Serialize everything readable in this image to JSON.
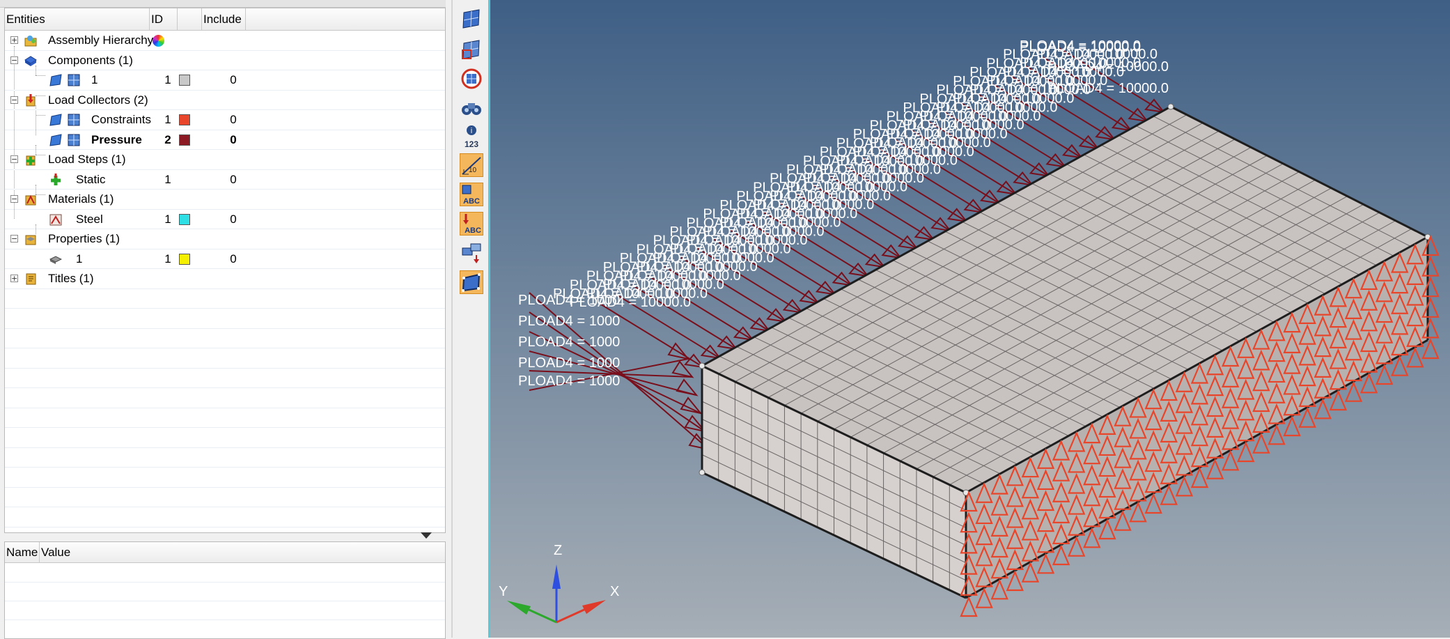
{
  "entities_panel": {
    "headers": {
      "entities": "Entities",
      "id": "ID",
      "include": "Include"
    },
    "rows": [
      {
        "label": "Assembly Hierarchy",
        "id": "",
        "include": "",
        "color": "",
        "bold": false
      },
      {
        "label": "Components (1)",
        "id": "",
        "include": "",
        "color": "",
        "bold": false
      },
      {
        "label": "1",
        "id": "1",
        "include": "0",
        "color": "#c8c8c8",
        "bold": false
      },
      {
        "label": "Load Collectors (2)",
        "id": "",
        "include": "",
        "color": "",
        "bold": false
      },
      {
        "label": "Constraints",
        "id": "1",
        "include": "0",
        "color": "#e8452a",
        "bold": false
      },
      {
        "label": "Pressure",
        "id": "2",
        "include": "0",
        "color": "#8b1a24",
        "bold": true
      },
      {
        "label": "Load Steps (1)",
        "id": "",
        "include": "",
        "color": "",
        "bold": false
      },
      {
        "label": "Static",
        "id": "1",
        "include": "0",
        "color": "",
        "bold": false
      },
      {
        "label": "Materials (1)",
        "id": "",
        "include": "",
        "color": "",
        "bold": false
      },
      {
        "label": "Steel",
        "id": "1",
        "include": "0",
        "color": "#2ee0e6",
        "bold": false
      },
      {
        "label": "Properties (1)",
        "id": "",
        "include": "",
        "color": "",
        "bold": false
      },
      {
        "label": "1",
        "id": "1",
        "include": "0",
        "color": "#f4f000",
        "bold": false
      },
      {
        "label": "Titles (1)",
        "id": "",
        "include": "",
        "color": "",
        "bold": false
      }
    ]
  },
  "properties_panel": {
    "headers": {
      "name": "Name",
      "value": "Value"
    }
  },
  "toolbar": {
    "icons": [
      "mesh-view-icon",
      "shaded-elements-icon",
      "element-color-icon",
      "find-binoculars-icon",
      "entity-numbers-icon",
      "scale-icon",
      "label-abc-icon",
      "load-label-abc-icon",
      "transform-icon",
      "component-edges-icon"
    ],
    "numbers_label": "123",
    "scale_label": "10"
  },
  "viewport": {
    "load_label": "PLOAD4 = 10000.0",
    "load_label_short": "PLOAD4 = 1000",
    "axis": {
      "x": "X",
      "y": "Y",
      "z": "Z"
    },
    "colors": {
      "pressure": "#7a0f1c",
      "constraints": "#e8452a",
      "mesh_face": "#c9c4c2",
      "mesh_line": "#3a3a3a"
    }
  }
}
